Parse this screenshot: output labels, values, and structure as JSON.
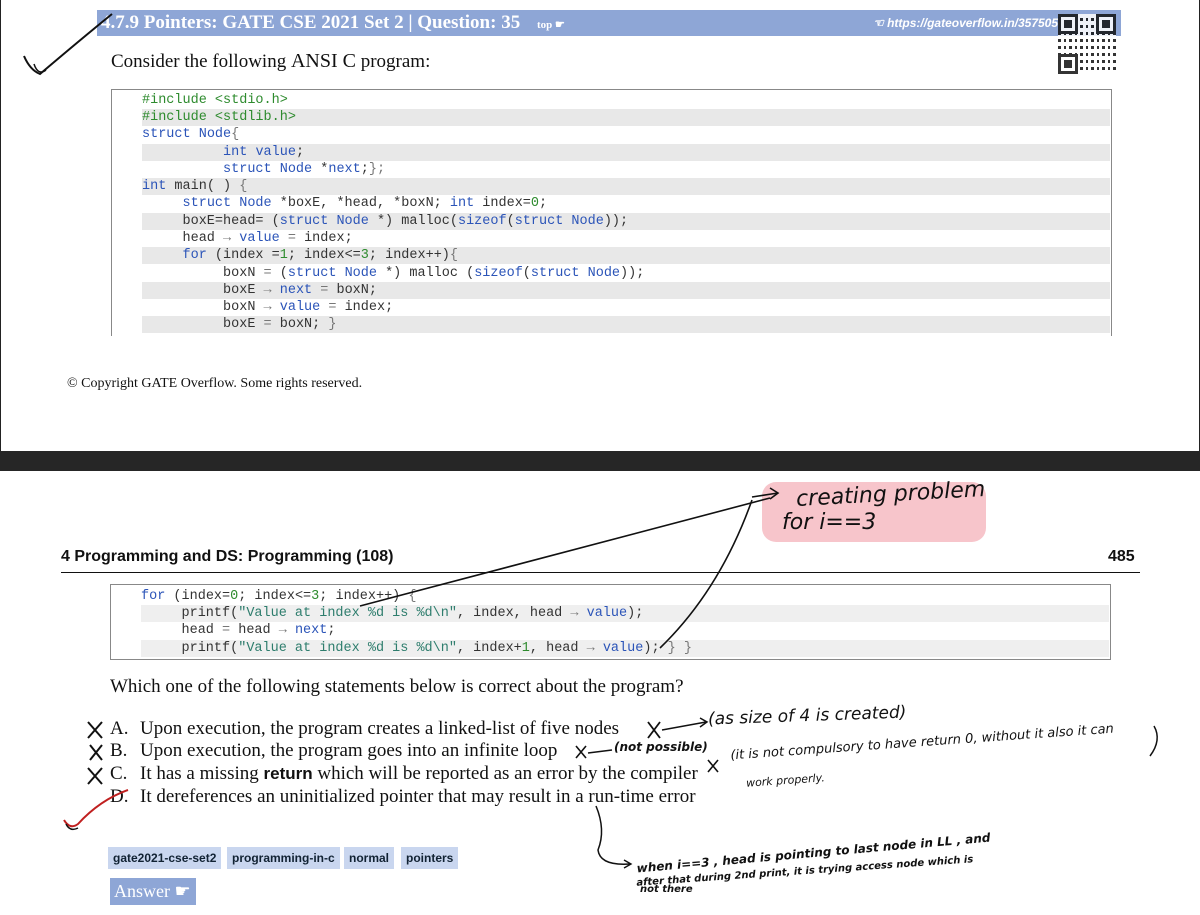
{
  "page1": {
    "header": {
      "title": "4.7.9 Pointers: GATE CSE 2021 Set 2 | Question: 35",
      "top_link": "top",
      "url": "https://gateoverflow.in/357505"
    },
    "intro_prefix": "Consider the following",
    "intro_lang": "ANSI C",
    "intro_suffix": "program:",
    "code": [
      "#include <stdio.h>",
      "#include <stdlib.h>",
      "struct Node{",
      "        int value;",
      "        struct Node *next;};",
      "int main( ) {",
      "    struct Node *boxE, *head, *boxN; int index=0;",
      "    boxE=head= (struct Node *) malloc(sizeof(struct Node));",
      "    head → value = index;",
      "    for (index =1; index<=3; index++){",
      "        boxN = (struct Node *) malloc (sizeof(struct Node));",
      "        boxE → next = boxN;",
      "        boxN → value = index;",
      "        boxE = boxN; }"
    ],
    "copyright": "© Copyright GATE Overflow. Some rights reserved."
  },
  "page2": {
    "section_title": "4 Programming and DS: Programming (108)",
    "page_number": "485",
    "code": [
      "    for (index=0; index<=3; index++) {",
      "        printf(\"Value at index %d is %d\\n\", index, head → value);",
      "        head = head → next;",
      "        printf(\"Value at index %d is %d\\n\", index+1, head → value); } }"
    ],
    "question": "Which one of the following statements below is correct about the program?",
    "options": [
      {
        "label": "A.",
        "text": "Upon execution, the program creates a linked-list of five nodes"
      },
      {
        "label": "B.",
        "text": "Upon execution, the program goes into an infinite loop"
      },
      {
        "label": "C.",
        "text_before": "It has a missing",
        "bold": "return",
        "text_after": "which will be reported as an error by the compiler"
      },
      {
        "label": "D.",
        "text": "It dereferences an uninitialized pointer that may result in a run-time error"
      }
    ],
    "tags": [
      "gate2021-cse-set2",
      "programming-in-c",
      "normal",
      "pointers"
    ],
    "answer_label": "Answer"
  },
  "annotations": {
    "creating_problem": "creating problem",
    "for_i": "for i==3",
    "note_a": "(as size of 4 is created)",
    "note_b": "(not possible)",
    "note_c1": "(it is not compulsory to have return 0, without it also it can",
    "note_c2": "work properly.",
    "note_d1": "when i==3 , head is pointing to last node in LL , and",
    "note_d2": "after that during 2nd print, it is trying access node which is",
    "note_d3": "not there",
    "cross": "X"
  },
  "colors": {
    "header_blue": "#8ea6d6",
    "tag_blue": "#c9d6ef",
    "keyword_blue": "#2b54b8",
    "string_green": "#2e8b2e",
    "highlight_pink": "#f096a0",
    "separator": "#262626"
  }
}
